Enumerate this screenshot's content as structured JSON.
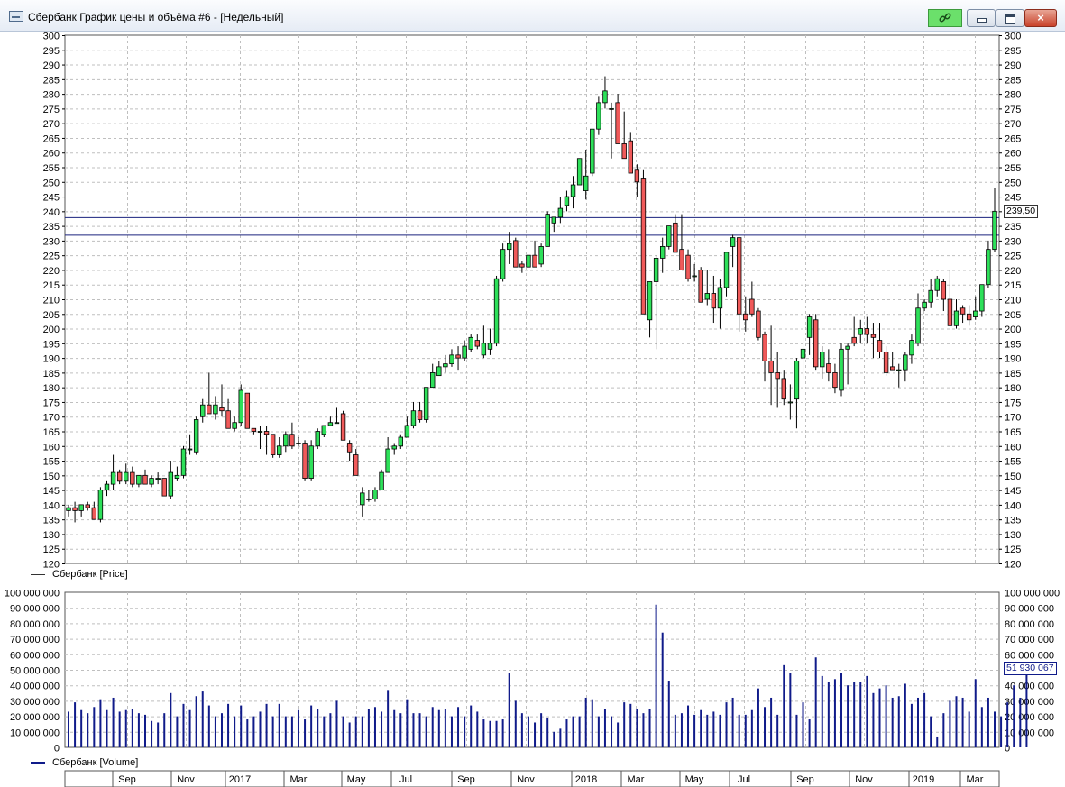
{
  "window": {
    "title": "Сбербанк График цены и объёма #6 - [Недельный]",
    "controls": {
      "close": "×"
    }
  },
  "price_panel": {
    "legend": "Сбербанк [Price]",
    "current_value_label": "239,50",
    "colors": {
      "up": "#2ee05a",
      "down": "#f05a5a",
      "outline": "#000000",
      "grid": "#bfbfbf",
      "hline": "#1a237e"
    }
  },
  "volume_panel": {
    "legend": "Сбербанк [Volume]",
    "current_value_label": "51 930 067",
    "colors": {
      "bar": "#101b8a"
    }
  },
  "x_axis": {
    "labels": [
      "Sep",
      "Nov",
      "2017",
      "Mar",
      "May",
      "Jul",
      "Sep",
      "Nov",
      "2018",
      "Mar",
      "May",
      "Jul",
      "Sep",
      "Nov",
      "2019",
      "Mar"
    ]
  },
  "chart_data": [
    {
      "type": "candlestick",
      "ylim": [
        120,
        300
      ],
      "yticks": [
        120,
        125,
        130,
        135,
        140,
        145,
        150,
        155,
        160,
        165,
        170,
        175,
        180,
        185,
        190,
        195,
        200,
        205,
        210,
        215,
        220,
        225,
        230,
        235,
        240,
        245,
        250,
        255,
        260,
        265,
        270,
        275,
        280,
        285,
        290,
        295,
        300
      ],
      "horizontal_lines": [
        238,
        232
      ],
      "grid": "dashed",
      "ohlc": [
        [
          138,
          140,
          136,
          139
        ],
        [
          139,
          141,
          134,
          138
        ],
        [
          138,
          140,
          136,
          140
        ],
        [
          140,
          141,
          138,
          139
        ],
        [
          139,
          141,
          135,
          135
        ],
        [
          135,
          146,
          134,
          145
        ],
        [
          145,
          148,
          143,
          147
        ],
        [
          147,
          157,
          145,
          151
        ],
        [
          151,
          152,
          147,
          148
        ],
        [
          148,
          154,
          147,
          151
        ],
        [
          151,
          153,
          146,
          147
        ],
        [
          147,
          150,
          146,
          150
        ],
        [
          150,
          152,
          147,
          147
        ],
        [
          147,
          150,
          146,
          149
        ],
        [
          149,
          151,
          147,
          149
        ],
        [
          149,
          149,
          143,
          143
        ],
        [
          143,
          155,
          142,
          151
        ],
        [
          149,
          153,
          148,
          150
        ],
        [
          150,
          160,
          149,
          159
        ],
        [
          159,
          164,
          157,
          159
        ],
        [
          158,
          170,
          157,
          169
        ],
        [
          170,
          176,
          168,
          174
        ],
        [
          174,
          185,
          172,
          171
        ],
        [
          171,
          177,
          169,
          174
        ],
        [
          173,
          181,
          170,
          172
        ],
        [
          172,
          176,
          166,
          166
        ],
        [
          166,
          170,
          165,
          168
        ],
        [
          168,
          181,
          167,
          179
        ],
        [
          178,
          178,
          166,
          166
        ],
        [
          166,
          166,
          164,
          165
        ],
        [
          165,
          167,
          159,
          165
        ],
        [
          165,
          167,
          157,
          164
        ],
        [
          164,
          164,
          156,
          157
        ],
        [
          157,
          163,
          156,
          160
        ],
        [
          160,
          165,
          158,
          164
        ],
        [
          164,
          168,
          159,
          160
        ],
        [
          161,
          163,
          160,
          161
        ],
        [
          161,
          162,
          148,
          149
        ],
        [
          149,
          162,
          148,
          160
        ],
        [
          160,
          166,
          159,
          165
        ],
        [
          164,
          167,
          163,
          167
        ],
        [
          167,
          170,
          167,
          168
        ],
        [
          168,
          173,
          168,
          168
        ],
        [
          171,
          172,
          163,
          162
        ],
        [
          161,
          162,
          155,
          158
        ],
        [
          157,
          159,
          150,
          150
        ],
        [
          140,
          146,
          136,
          144
        ],
        [
          142,
          145,
          141,
          142
        ],
        [
          142,
          146,
          141,
          145
        ],
        [
          145,
          152,
          145,
          151
        ],
        [
          151,
          163,
          151,
          159
        ],
        [
          159,
          161,
          157,
          160
        ],
        [
          160,
          164,
          159,
          163
        ],
        [
          163,
          170,
          163,
          167
        ],
        [
          167,
          175,
          166,
          172
        ],
        [
          172,
          175,
          168,
          169
        ],
        [
          169,
          180,
          168,
          180
        ],
        [
          180,
          188,
          180,
          185
        ],
        [
          184,
          189,
          184,
          187
        ],
        [
          187,
          191,
          185,
          188
        ],
        [
          188,
          193,
          187,
          191
        ],
        [
          191,
          194,
          186,
          190
        ],
        [
          190,
          196,
          189,
          194
        ],
        [
          193,
          198,
          192,
          197
        ],
        [
          196,
          198,
          193,
          194
        ],
        [
          191,
          201,
          190,
          195
        ],
        [
          193,
          200,
          191,
          195
        ],
        [
          195,
          218,
          194,
          217
        ],
        [
          217,
          229,
          216,
          227
        ],
        [
          227,
          233,
          222,
          229
        ],
        [
          230,
          231,
          222,
          221
        ],
        [
          222,
          223,
          219,
          221
        ],
        [
          221,
          225,
          221,
          225
        ],
        [
          225,
          230,
          221,
          221
        ],
        [
          222,
          229,
          221,
          228
        ],
        [
          228,
          240,
          228,
          239
        ],
        [
          236,
          238,
          233,
          238
        ],
        [
          238,
          245,
          236,
          241
        ],
        [
          242,
          247,
          240,
          245
        ],
        [
          245,
          252,
          241,
          249
        ],
        [
          249,
          258,
          249,
          258
        ],
        [
          247,
          261,
          244,
          252
        ],
        [
          253,
          265,
          252,
          268
        ],
        [
          268,
          279,
          266,
          277
        ],
        [
          277,
          286,
          275,
          281
        ],
        [
          275,
          277,
          258,
          275
        ],
        [
          277,
          280,
          265,
          263
        ],
        [
          263,
          274,
          262,
          258
        ],
        [
          264,
          267,
          255,
          253
        ],
        [
          254,
          256,
          245,
          250
        ],
        [
          251,
          254,
          221,
          205
        ],
        [
          203,
          216,
          197,
          216
        ],
        [
          216,
          225,
          193,
          224
        ],
        [
          224,
          231,
          219,
          228
        ],
        [
          228,
          235,
          227,
          235
        ],
        [
          236,
          239,
          227,
          226
        ],
        [
          227,
          239,
          223,
          220
        ],
        [
          225,
          227,
          216,
          217
        ],
        [
          218,
          222,
          216,
          218
        ],
        [
          220,
          221,
          210,
          209
        ],
        [
          210,
          220,
          208,
          212
        ],
        [
          212,
          218,
          202,
          207
        ],
        [
          207,
          217,
          200,
          214
        ],
        [
          214,
          226,
          211,
          226
        ],
        [
          228,
          232,
          221,
          231
        ],
        [
          231,
          231,
          199,
          205
        ],
        [
          205,
          211,
          199,
          203
        ],
        [
          210,
          216,
          204,
          205
        ],
        [
          206,
          207,
          196,
          197
        ],
        [
          198,
          199,
          182,
          189
        ],
        [
          189,
          201,
          174,
          185
        ],
        [
          185,
          192,
          173,
          183
        ],
        [
          183,
          186,
          174,
          176
        ],
        [
          175,
          181,
          169,
          175
        ],
        [
          176,
          190,
          166,
          189
        ],
        [
          190,
          197,
          183,
          193
        ],
        [
          197,
          205,
          191,
          204
        ],
        [
          203,
          205,
          186,
          187
        ],
        [
          187,
          194,
          183,
          192
        ],
        [
          188,
          193,
          182,
          185
        ],
        [
          185,
          188,
          178,
          180
        ],
        [
          179,
          195,
          177,
          193
        ],
        [
          193,
          195,
          181,
          194
        ],
        [
          197,
          204,
          194,
          195
        ],
        [
          198,
          203,
          195,
          200
        ],
        [
          200,
          204,
          195,
          198
        ],
        [
          198,
          202,
          190,
          197
        ],
        [
          196,
          202,
          190,
          192
        ],
        [
          192,
          194,
          184,
          185
        ],
        [
          187,
          192,
          186,
          186
        ],
        [
          186,
          188,
          180,
          186
        ],
        [
          186,
          192,
          182,
          191
        ],
        [
          191,
          198,
          188,
          196
        ],
        [
          195,
          212,
          194,
          207
        ],
        [
          207,
          210,
          206,
          209
        ],
        [
          209,
          217,
          207,
          213
        ],
        [
          213,
          218,
          211,
          217
        ],
        [
          216,
          217,
          206,
          210
        ],
        [
          210,
          220,
          208,
          201
        ],
        [
          201,
          210,
          200,
          206
        ],
        [
          207,
          208,
          202,
          205
        ],
        [
          205,
          208,
          201,
          203
        ],
        [
          204,
          211,
          203,
          206
        ],
        [
          206,
          215,
          204,
          215
        ],
        [
          215,
          230,
          214,
          227
        ],
        [
          227,
          248,
          226,
          240
        ]
      ]
    },
    {
      "type": "bar",
      "ylim": [
        0,
        100000000
      ],
      "yticks": [
        0,
        10000000,
        20000000,
        30000000,
        40000000,
        50000000,
        60000000,
        70000000,
        80000000,
        90000000,
        100000000
      ],
      "ytick_labels": [
        "0",
        "10 000 000",
        "20 000 000",
        "30 000 000",
        "40 000 000",
        "50 000 000",
        "60 000 000",
        "70 000 000",
        "80 000 000",
        "90 000 000",
        "100 000 000"
      ],
      "values": [
        23,
        29,
        24,
        22,
        26,
        31,
        24,
        32,
        23,
        24,
        25,
        22,
        21,
        17,
        16,
        22,
        35,
        20,
        28,
        24,
        33,
        36,
        27,
        20,
        22,
        28,
        20,
        27,
        18,
        20,
        23,
        28,
        20,
        28,
        20,
        20,
        24,
        18,
        27,
        25,
        20,
        22,
        30,
        20,
        16,
        20,
        20,
        25,
        26,
        23,
        37,
        24,
        22,
        31,
        22,
        22,
        20,
        26,
        24,
        25,
        20,
        26,
        20,
        27,
        23,
        18,
        17,
        17,
        18,
        48,
        30,
        22,
        20,
        16,
        22,
        19,
        10,
        12,
        18,
        20,
        20,
        32,
        31,
        20,
        25,
        20,
        16,
        29,
        28,
        25,
        22,
        25,
        92,
        74,
        43,
        21,
        22,
        27,
        21,
        24,
        21,
        23,
        21,
        29,
        32,
        21,
        21,
        24,
        38,
        26,
        32,
        21,
        53,
        48,
        21,
        29,
        18,
        58,
        46,
        42,
        44,
        48,
        40,
        42,
        42,
        46,
        35,
        38,
        40,
        32,
        33,
        41,
        28,
        32,
        35,
        20,
        7,
        22,
        30,
        33,
        32,
        23,
        44,
        26,
        32,
        23,
        20,
        29,
        40,
        32,
        52
      ]
    }
  ]
}
